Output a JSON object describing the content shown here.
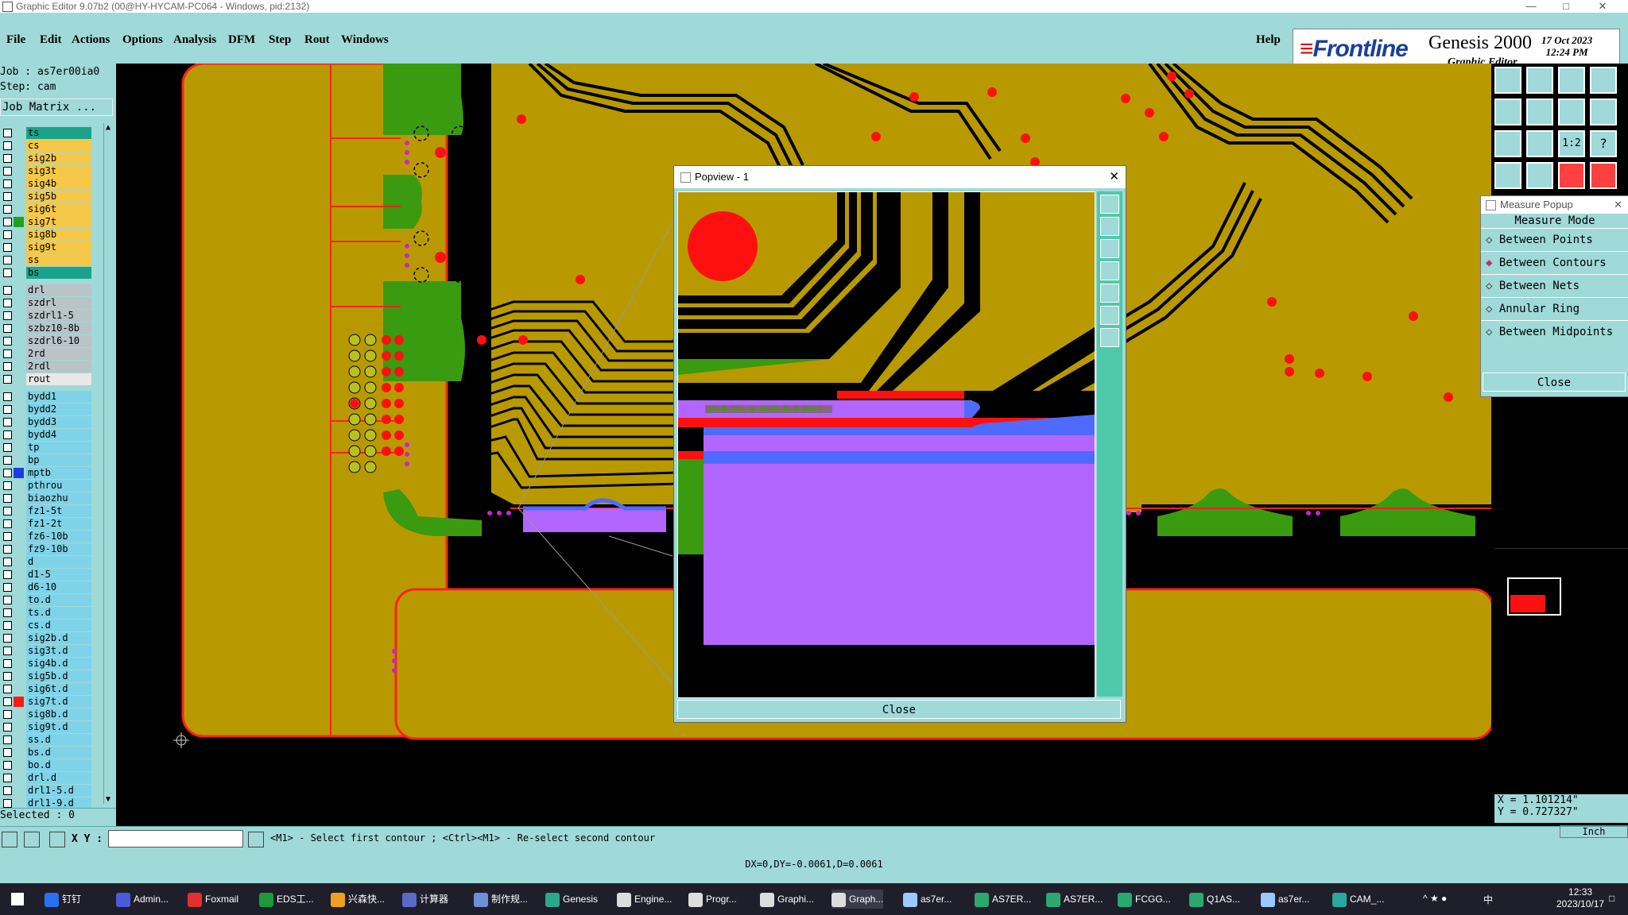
{
  "window": {
    "title": "Graphic Editor 9.07b2 (00@HY-HYCAM-PC064 - Windows, pid:2132)"
  },
  "menu": {
    "items": [
      "File",
      "Edit",
      "Actions",
      "Options",
      "Analysis",
      "DFM",
      "Step",
      "Rout",
      "Windows"
    ],
    "help": "Help"
  },
  "brand": {
    "logo": "Frontline",
    "product": "Genesis 2000",
    "subtitle": "Graphic Editor",
    "date": "17 Oct 2023",
    "time": "12:24 PM"
  },
  "job": {
    "job_line": "Job : as7er00ia0",
    "step_line": "Step: cam",
    "matrix_button": "Job Matrix ..."
  },
  "layers": [
    {
      "name": "ts",
      "bg": "#1aa38a",
      "sw": ""
    },
    {
      "name": "cs",
      "bg": "#f5c84a",
      "sw": ""
    },
    {
      "name": "sig2b",
      "bg": "#f5c84a",
      "sw": ""
    },
    {
      "name": "sig3t",
      "bg": "#f5c84a",
      "sw": ""
    },
    {
      "name": "sig4b",
      "bg": "#f5c84a",
      "sw": ""
    },
    {
      "name": "sig5b",
      "bg": "#f5c84a",
      "sw": ""
    },
    {
      "name": "sig6t",
      "bg": "#f5c84a",
      "sw": ""
    },
    {
      "name": "sig7t",
      "bg": "#f5c84a",
      "sw": "#22a022"
    },
    {
      "name": "sig8b",
      "bg": "#f5c84a",
      "sw": ""
    },
    {
      "name": "sig9t",
      "bg": "#f5c84a",
      "sw": ""
    },
    {
      "name": "ss",
      "bg": "#f5c84a",
      "sw": ""
    },
    {
      "name": "bs",
      "bg": "#1aa38a",
      "sw": ""
    },
    {
      "gap": true
    },
    {
      "name": "drl",
      "bg": "#b8c4c8",
      "sw": ""
    },
    {
      "name": "szdrl",
      "bg": "#b8c4c8",
      "sw": ""
    },
    {
      "name": "szdrl1-5",
      "bg": "#b8c4c8",
      "sw": ""
    },
    {
      "name": "szbz10-8b",
      "bg": "#b8c4c8",
      "sw": ""
    },
    {
      "name": "szdrl6-10",
      "bg": "#b8c4c8",
      "sw": ""
    },
    {
      "name": "2rd",
      "bg": "#b8c4c8",
      "sw": ""
    },
    {
      "name": "2rdl",
      "bg": "#b8c4c8",
      "sw": ""
    },
    {
      "name": "rout",
      "bg": "#e8e8e8",
      "sw": ""
    },
    {
      "gap": true
    },
    {
      "name": "bydd1",
      "bg": "#7fd3e8",
      "sw": ""
    },
    {
      "name": "bydd2",
      "bg": "#7fd3e8",
      "sw": ""
    },
    {
      "name": "bydd3",
      "bg": "#7fd3e8",
      "sw": ""
    },
    {
      "name": "bydd4",
      "bg": "#7fd3e8",
      "sw": ""
    },
    {
      "name": "tp",
      "bg": "#7fd3e8",
      "sw": ""
    },
    {
      "name": "bp",
      "bg": "#7fd3e8",
      "sw": ""
    },
    {
      "name": "mptb",
      "bg": "#7fd3e8",
      "sw": "#1a3fe0"
    },
    {
      "name": "pthrou",
      "bg": "#7fd3e8",
      "sw": ""
    },
    {
      "name": "biaozhu",
      "bg": "#7fd3e8",
      "sw": ""
    },
    {
      "name": "fz1-5t",
      "bg": "#7fd3e8",
      "sw": ""
    },
    {
      "name": "fz1-2t",
      "bg": "#7fd3e8",
      "sw": ""
    },
    {
      "name": "fz6-10b",
      "bg": "#7fd3e8",
      "sw": ""
    },
    {
      "name": "fz9-10b",
      "bg": "#7fd3e8",
      "sw": ""
    },
    {
      "name": "d",
      "bg": "#7fd3e8",
      "sw": ""
    },
    {
      "name": "d1-5",
      "bg": "#7fd3e8",
      "sw": ""
    },
    {
      "name": "d6-10",
      "bg": "#7fd3e8",
      "sw": ""
    },
    {
      "name": "to.d",
      "bg": "#7fd3e8",
      "sw": "",
      "ic": true
    },
    {
      "name": "ts.d",
      "bg": "#7fd3e8",
      "sw": "",
      "ic": true
    },
    {
      "name": "cs.d",
      "bg": "#7fd3e8",
      "sw": "",
      "ic": true
    },
    {
      "name": "sig2b.d",
      "bg": "#7fd3e8",
      "sw": "",
      "ic": true
    },
    {
      "name": "sig3t.d",
      "bg": "#7fd3e8",
      "sw": "",
      "ic": true
    },
    {
      "name": "sig4b.d",
      "bg": "#7fd3e8",
      "sw": "",
      "ic": true
    },
    {
      "name": "sig5b.d",
      "bg": "#7fd3e8",
      "sw": "",
      "ic": true
    },
    {
      "name": "sig6t.d",
      "bg": "#7fd3e8",
      "sw": "",
      "ic": true
    },
    {
      "name": "sig7t.d",
      "bg": "#7fd3e8",
      "sw": "#ff1a1a",
      "ic": true
    },
    {
      "name": "sig8b.d",
      "bg": "#7fd3e8",
      "sw": "",
      "ic": true
    },
    {
      "name": "sig9t.d",
      "bg": "#7fd3e8",
      "sw": "",
      "ic": true
    },
    {
      "name": "ss.d",
      "bg": "#7fd3e8",
      "sw": "",
      "ic": true
    },
    {
      "name": "bs.d",
      "bg": "#7fd3e8",
      "sw": "",
      "ic": true
    },
    {
      "name": "bo.d",
      "bg": "#7fd3e8",
      "sw": "",
      "ic": true
    },
    {
      "name": "drl.d",
      "bg": "#7fd3e8",
      "sw": ""
    },
    {
      "name": "drl1-5.d",
      "bg": "#7fd3e8",
      "sw": ""
    },
    {
      "name": "drl1-9.d",
      "bg": "#7fd3e8",
      "sw": ""
    }
  ],
  "selected_text": "Selected : 0",
  "popview": {
    "title": "Popview - 1",
    "measure_label": "DX=0,DY=-0.0061,D=0.0061",
    "close": "Close"
  },
  "measure": {
    "title": "Measure Popup",
    "mode_label": "Measure Mode",
    "options": [
      "Between Points",
      "Between Contours",
      "Between Nets",
      "Annular Ring",
      "Between Midpoints"
    ],
    "selected_index": 1,
    "close": "Close"
  },
  "coords": {
    "x": "X = 1.101214\"",
    "y": "Y = 0.727327\"",
    "unit": "Inch"
  },
  "command": {
    "xy_label": "X Y :",
    "status": "<M1> - Select first contour ; <Ctrl><M1> - Re-select second contour",
    "dx_line": "DX=0,DY=-0.0061,D=0.0061"
  },
  "taskbar": {
    "items": [
      "钉钉",
      "Admin...",
      "Foxmail",
      "EDS工...",
      "兴森快...",
      "计算器",
      "制作规...",
      "Genesis",
      "Engine...",
      "Progr...",
      "Graphi...",
      "Graph...",
      "as7er...",
      "AS7ER...",
      "AS7ER...",
      "FCGG...",
      "Q1AS...",
      "as7er...",
      "CAM_..."
    ],
    "time": "12:33",
    "date": "2023/10/17",
    "ime": "中"
  },
  "colors": {
    "board": "#b89a00",
    "trace": "#000000",
    "copper_green": "#3a9a10",
    "pad_red": "#ff1010",
    "outline_red": "#ff2020",
    "highlight": "#b266ff",
    "highlight_edge": "#4f6bff",
    "ui_teal": "#9fd9d8"
  }
}
